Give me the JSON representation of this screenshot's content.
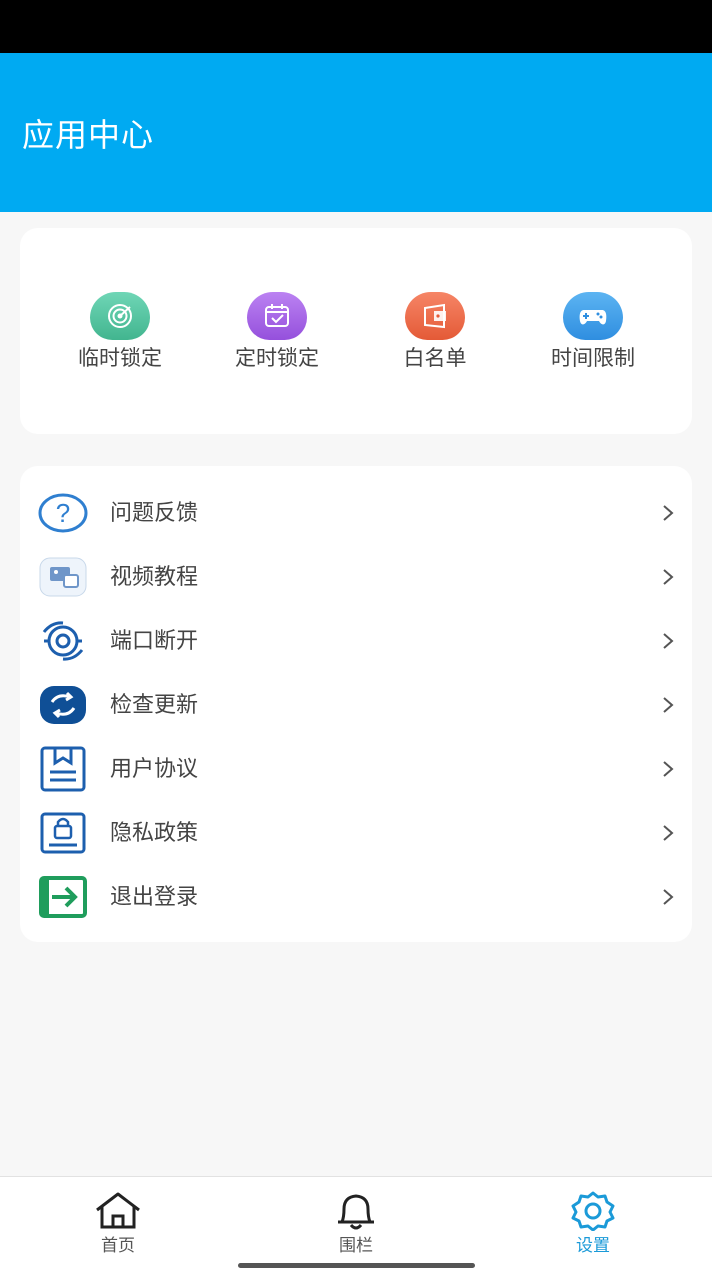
{
  "header": {
    "title": "应用中心"
  },
  "quick_actions": [
    {
      "label": "临时锁定",
      "icon": "target-icon",
      "color": "#5cc7a6"
    },
    {
      "label": "定时锁定",
      "icon": "calendar-icon",
      "color": "#a869e8"
    },
    {
      "label": "白名单",
      "icon": "wallet-icon",
      "color": "#f0714f"
    },
    {
      "label": "时间限制",
      "icon": "gamepad-icon",
      "color": "#3e9ee8"
    }
  ],
  "menu": [
    {
      "label": "问题反馈",
      "icon": "question-icon"
    },
    {
      "label": "视频教程",
      "icon": "video-tutorial-icon"
    },
    {
      "label": "端口断开",
      "icon": "disconnect-icon"
    },
    {
      "label": "检查更新",
      "icon": "refresh-icon"
    },
    {
      "label": "用户协议",
      "icon": "agreement-icon"
    },
    {
      "label": "隐私政策",
      "icon": "privacy-lock-icon"
    },
    {
      "label": "退出登录",
      "icon": "logout-icon"
    }
  ],
  "bottom_nav": [
    {
      "label": "首页",
      "icon": "home-icon",
      "active": false
    },
    {
      "label": "围栏",
      "icon": "bell-icon",
      "active": false
    },
    {
      "label": "设置",
      "icon": "settings-gear-icon",
      "active": true
    }
  ],
  "colors": {
    "header_bg": "#00aaf2",
    "accent": "#1b9ad8",
    "page_bg": "#f7f7f7"
  }
}
